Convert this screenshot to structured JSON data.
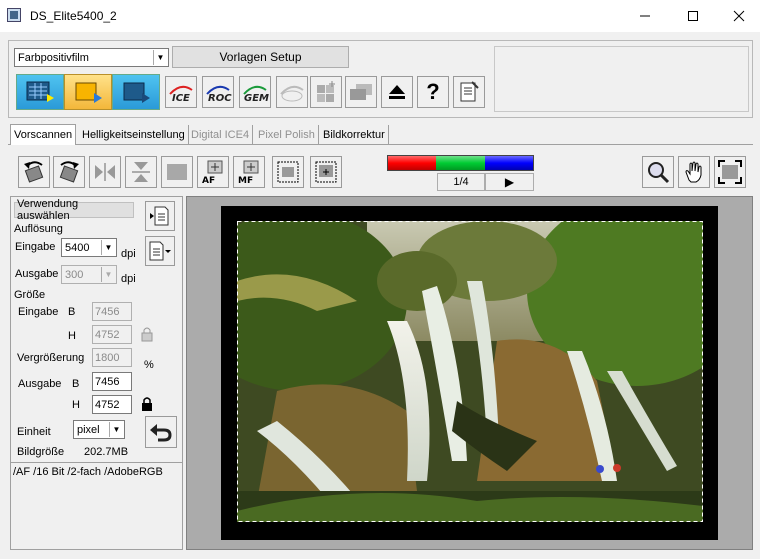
{
  "window": {
    "title": "DS_Elite5400_2"
  },
  "film_type": {
    "value": "Farbpositivfilm"
  },
  "setup_button": {
    "label": "Vorlagen Setup"
  },
  "mode_buttons": [
    "ICE",
    "ROC",
    "GEM"
  ],
  "help_glyph": "?",
  "tabs": [
    {
      "label": "Vorscannen",
      "active": true
    },
    {
      "label": "Helligkeitseinstellung",
      "active": false
    },
    {
      "label": "Digital ICE4",
      "active": false,
      "disabled": true
    },
    {
      "label": "Pixel Polish",
      "active": false,
      "disabled": true
    },
    {
      "label": "Bildkorrektur",
      "active": false
    }
  ],
  "toolbar": {
    "af_label": "AF",
    "mf_label": "MF"
  },
  "frame_nav": {
    "value": "1/4",
    "play_glyph": "▶"
  },
  "channel_bar": {
    "colors": [
      "#ff0000",
      "#00cc33",
      "#0000ff"
    ]
  },
  "settings": {
    "usage_label": "Verwendung auswählen",
    "resolution_label": "Auflösung",
    "input_label": "Eingabe",
    "input_value": "5400",
    "dpi_unit": "dpi",
    "output_label": "Ausgabe",
    "output_value": "300",
    "size_label": "Größe",
    "b_label": "B",
    "h_label": "H",
    "size_input_b": "7456",
    "size_input_h": "4752",
    "magnification_label": "Vergrößerung",
    "magnification_value": "1800",
    "percent_unit": "%",
    "size_output_label": "Ausgabe",
    "size_output_b": "7456",
    "size_output_h": "4752",
    "unit_label": "Einheit",
    "unit_value": "pixel",
    "filesize_label": "Bildgröße",
    "filesize_value": "202.7MB"
  },
  "status": {
    "text": "/AF /16 Bit /2-fach /AdobeRGB"
  }
}
